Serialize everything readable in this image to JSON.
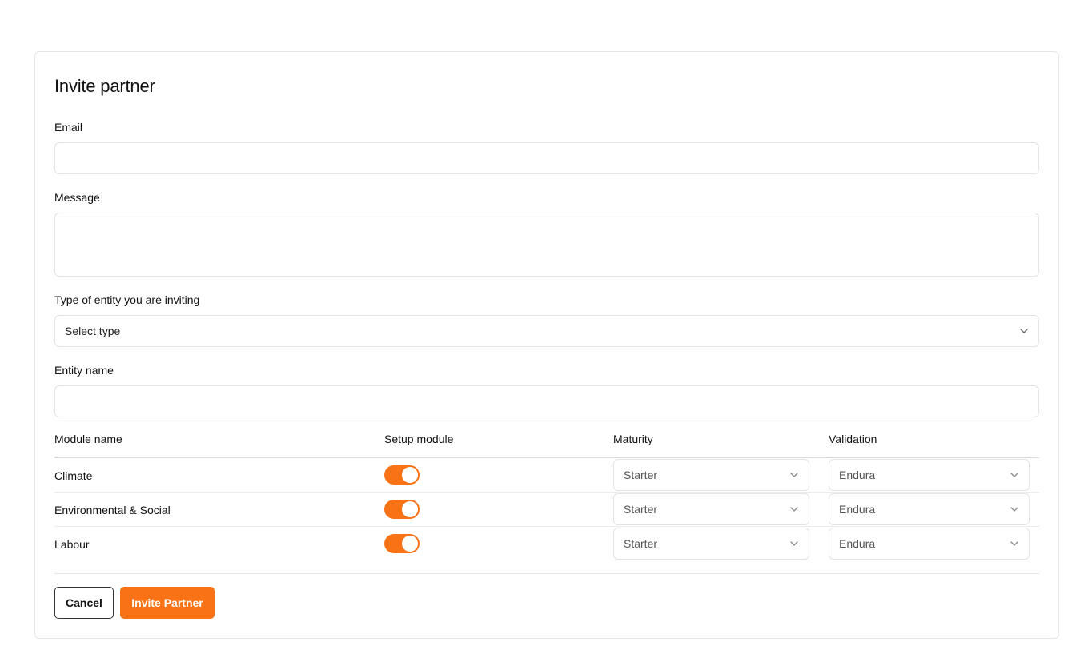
{
  "form": {
    "title": "Invite partner",
    "email_label": "Email",
    "email_value": "",
    "message_label": "Message",
    "message_value": "",
    "entity_type_label": "Type of entity you are inviting",
    "entity_type_value": "Select type",
    "entity_name_label": "Entity name",
    "entity_name_value": ""
  },
  "modules": {
    "headers": {
      "name": "Module name",
      "setup": "Setup module",
      "maturity": "Maturity",
      "validation": "Validation"
    },
    "rows": [
      {
        "name": "Climate",
        "setup_enabled": true,
        "maturity": "Starter",
        "validation": "Endura"
      },
      {
        "name": "Environmental & Social",
        "setup_enabled": true,
        "maturity": "Starter",
        "validation": "Endura"
      },
      {
        "name": "Labour",
        "setup_enabled": true,
        "maturity": "Starter",
        "validation": "Endura"
      }
    ]
  },
  "actions": {
    "cancel_label": "Cancel",
    "invite_label": "Invite Partner"
  },
  "colors": {
    "accent": "#f97316",
    "border": "#e3e3e3"
  },
  "icons": {
    "dropdown": "chevron-down-icon"
  }
}
